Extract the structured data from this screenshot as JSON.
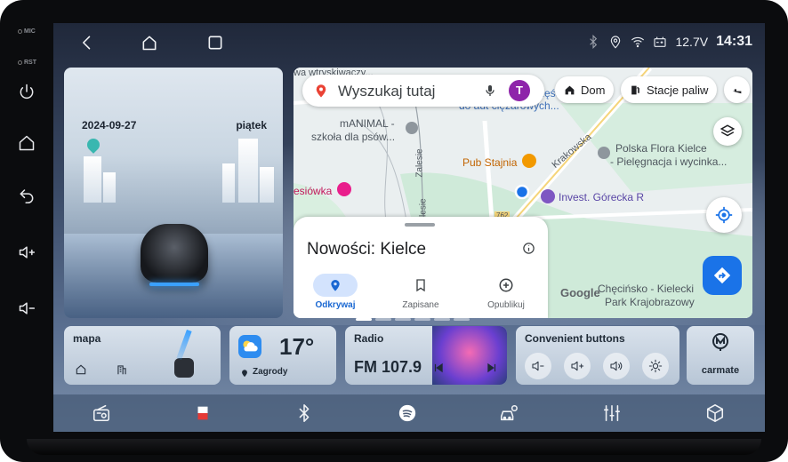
{
  "bezel": {
    "mic_label": "MIC",
    "rst_label": "RST"
  },
  "status": {
    "voltage": "12.7V",
    "time": "14:31"
  },
  "car_card": {
    "date": "2024-09-27",
    "weekday": "piątek"
  },
  "map": {
    "search_placeholder": "Wyszukaj tutaj",
    "avatar_letter": "T",
    "chips": [
      "Dom",
      "Stacje paliw"
    ],
    "labels": {
      "top_cut": "wa wtryskiwaczy...",
      "truck_cut": "do aut ciężarowych...",
      "animal_1": "mANIMAL -",
      "animal_2": "szkoła dla psów...",
      "pub": "Pub Stajnia",
      "krakowska": "Krakowska",
      "zalesie_1": "Zalesie",
      "zalesie_2": "Zalesie",
      "polska_flora_1": "Polska Flora Kielce",
      "polska_flora_2": "- Pielęgnacja i wycinka...",
      "invest": "Invest. Górecka R",
      "esiowka": "esiówka",
      "road_num": "762",
      "checinsko_1": "Chęcińsko - Kielecki",
      "checinsko_2": "Park Krajobrazowy",
      "google": "Google",
      "zesc": "zęśc"
    },
    "sheet": {
      "title": "Nowości: Kielce",
      "tabs": [
        "Odkrywaj",
        "Zapisane",
        "Opublikuj"
      ],
      "active_tab": "Odkrywaj"
    }
  },
  "widgets": {
    "mapa": {
      "title": "mapa"
    },
    "weather": {
      "temp": "17°",
      "location": "Zagrody"
    },
    "radio": {
      "title": "Radio",
      "station": "FM 107.9"
    },
    "convenient": {
      "title": "Convenient buttons"
    },
    "carmate": {
      "label": "carmate"
    }
  },
  "colors": {
    "map_blue": "#1a73e8",
    "accent_purple": "#8e24aa",
    "pub_orange": "#f29900"
  }
}
